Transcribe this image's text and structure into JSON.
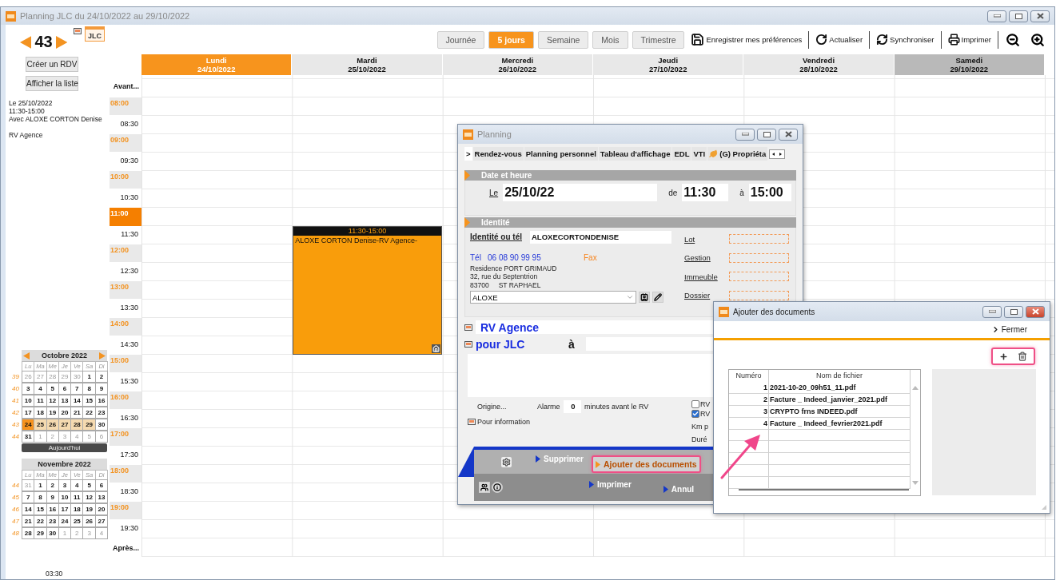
{
  "window": {
    "title": "Planning JLC du 24/10/2022 au 29/10/2022"
  },
  "week": {
    "number": "43"
  },
  "agenda_badge": "JLC",
  "views": [
    {
      "label": "Journée",
      "selected": false
    },
    {
      "label": "5 jours",
      "selected": true
    },
    {
      "label": "Semaine",
      "selected": false
    },
    {
      "label": "Mois",
      "selected": false
    },
    {
      "label": "Trimestre",
      "selected": false
    }
  ],
  "tools": [
    {
      "kind": "save",
      "label": "Enregistrer mes préférences"
    },
    {
      "kind": "refresh",
      "label": "Actualiser"
    },
    {
      "kind": "sync",
      "label": "Synchroniser"
    },
    {
      "kind": "print",
      "label": "Imprimer"
    },
    {
      "kind": "zoom-out"
    },
    {
      "kind": "zoom-in"
    }
  ],
  "sidebar": {
    "buttons": [
      "Créer un RDV",
      "Afficher la liste"
    ],
    "summary": [
      "Le 25/10/2022",
      "11:30-15:00",
      "Avec ALOXE CORTON Denise"
    ],
    "note": "RV Agence",
    "calendars": [
      {
        "title": "Octobre 2022",
        "nav": true,
        "weekdays": [
          "Lu",
          "Ma",
          "Me",
          "Je",
          "Ve",
          "Sa",
          "Di"
        ],
        "today_button": "Aujourd'hui",
        "weeks": [
          {
            "number": "39",
            "days": [
              {
                "label": "26",
                "kind": "outside"
              },
              {
                "label": "27",
                "kind": "outside"
              },
              {
                "label": "28",
                "kind": "outside"
              },
              {
                "label": "29",
                "kind": "outside"
              },
              {
                "label": "30",
                "kind": "outside"
              },
              {
                "label": "1",
                "kind": "day"
              },
              {
                "label": "2",
                "kind": "day"
              }
            ]
          },
          {
            "number": "40",
            "days": [
              {
                "label": "3",
                "kind": "day"
              },
              {
                "label": "4",
                "kind": "day"
              },
              {
                "label": "5",
                "kind": "day"
              },
              {
                "label": "6",
                "kind": "day"
              },
              {
                "label": "7",
                "kind": "day"
              },
              {
                "label": "8",
                "kind": "day"
              },
              {
                "label": "9",
                "kind": "day"
              }
            ]
          },
          {
            "number": "41",
            "days": [
              {
                "label": "10",
                "kind": "day"
              },
              {
                "label": "11",
                "kind": "day"
              },
              {
                "label": "12",
                "kind": "day"
              },
              {
                "label": "13",
                "kind": "day"
              },
              {
                "label": "14",
                "kind": "day"
              },
              {
                "label": "15",
                "kind": "day"
              },
              {
                "label": "16",
                "kind": "day"
              }
            ]
          },
          {
            "number": "42",
            "days": [
              {
                "label": "17",
                "kind": "day"
              },
              {
                "label": "18",
                "kind": "day"
              },
              {
                "label": "19",
                "kind": "day"
              },
              {
                "label": "20",
                "kind": "day"
              },
              {
                "label": "21",
                "kind": "day"
              },
              {
                "label": "22",
                "kind": "day"
              },
              {
                "label": "23",
                "kind": "day"
              }
            ]
          },
          {
            "number": "43",
            "days": [
              {
                "label": "24",
                "kind": "today"
              },
              {
                "label": "25",
                "kind": "range"
              },
              {
                "label": "26",
                "kind": "range"
              },
              {
                "label": "27",
                "kind": "range"
              },
              {
                "label": "28",
                "kind": "range"
              },
              {
                "label": "29",
                "kind": "range"
              },
              {
                "label": "30",
                "kind": "day"
              }
            ]
          },
          {
            "number": "44",
            "days": [
              {
                "label": "31",
                "kind": "day"
              },
              {
                "label": "1",
                "kind": "outside"
              },
              {
                "label": "2",
                "kind": "outside"
              },
              {
                "label": "3",
                "kind": "outside"
              },
              {
                "label": "4",
                "kind": "outside"
              },
              {
                "label": "5",
                "kind": "outside"
              },
              {
                "label": "6",
                "kind": "outside"
              }
            ]
          }
        ]
      },
      {
        "title": "Novembre 2022",
        "nav": false,
        "weekdays": [
          "Lu",
          "Ma",
          "Me",
          "Je",
          "Ve",
          "Sa",
          "Di"
        ],
        "weeks": [
          {
            "number": "44",
            "days": [
              {
                "label": "31",
                "kind": "outside"
              },
              {
                "label": "1",
                "kind": "day"
              },
              {
                "label": "2",
                "kind": "day"
              },
              {
                "label": "3",
                "kind": "day"
              },
              {
                "label": "4",
                "kind": "day"
              },
              {
                "label": "5",
                "kind": "day"
              },
              {
                "label": "6",
                "kind": "day"
              }
            ]
          },
          {
            "number": "45",
            "days": [
              {
                "label": "7",
                "kind": "day"
              },
              {
                "label": "8",
                "kind": "day"
              },
              {
                "label": "9",
                "kind": "day"
              },
              {
                "label": "10",
                "kind": "day"
              },
              {
                "label": "11",
                "kind": "day"
              },
              {
                "label": "12",
                "kind": "day"
              },
              {
                "label": "13",
                "kind": "day"
              }
            ]
          },
          {
            "number": "46",
            "days": [
              {
                "label": "14",
                "kind": "day"
              },
              {
                "label": "15",
                "kind": "day"
              },
              {
                "label": "16",
                "kind": "day"
              },
              {
                "label": "17",
                "kind": "day"
              },
              {
                "label": "18",
                "kind": "day"
              },
              {
                "label": "19",
                "kind": "day"
              },
              {
                "label": "20",
                "kind": "day"
              }
            ]
          },
          {
            "number": "47",
            "days": [
              {
                "label": "21",
                "kind": "day"
              },
              {
                "label": "22",
                "kind": "day"
              },
              {
                "label": "23",
                "kind": "day"
              },
              {
                "label": "24",
                "kind": "day"
              },
              {
                "label": "25",
                "kind": "day"
              },
              {
                "label": "26",
                "kind": "day"
              },
              {
                "label": "27",
                "kind": "day"
              }
            ]
          },
          {
            "number": "48",
            "days": [
              {
                "label": "28",
                "kind": "day"
              },
              {
                "label": "29",
                "kind": "day"
              },
              {
                "label": "30",
                "kind": "day"
              },
              {
                "label": "1",
                "kind": "outside"
              },
              {
                "label": "2",
                "kind": "outside"
              },
              {
                "label": "3",
                "kind": "outside"
              },
              {
                "label": "4",
                "kind": "outside"
              }
            ]
          }
        ]
      }
    ],
    "footer_time": "03:30"
  },
  "days": [
    {
      "name": "Lundi",
      "date": "24/10/2022",
      "kind": "today"
    },
    {
      "name": "Mardi",
      "date": "25/10/2022",
      "kind": "day"
    },
    {
      "name": "Mercredi",
      "date": "26/10/2022",
      "kind": "day"
    },
    {
      "name": "Jeudi",
      "date": "27/10/2022",
      "kind": "day"
    },
    {
      "name": "Vendredi",
      "date": "28/10/2022",
      "kind": "day"
    },
    {
      "name": "Samedi",
      "date": "29/10/2022",
      "kind": "weekend"
    }
  ],
  "times": [
    {
      "label": "Avant...",
      "kind": "edge"
    },
    {
      "label": "08:00",
      "kind": "hour"
    },
    {
      "label": "08:30",
      "kind": "half"
    },
    {
      "label": "09:00",
      "kind": "hour"
    },
    {
      "label": "09:30",
      "kind": "half"
    },
    {
      "label": "10:00",
      "kind": "hour"
    },
    {
      "label": "10:30",
      "kind": "half"
    },
    {
      "label": "11:00",
      "kind": "current"
    },
    {
      "label": "11:30",
      "kind": "half"
    },
    {
      "label": "12:00",
      "kind": "hour"
    },
    {
      "label": "12:30",
      "kind": "half"
    },
    {
      "label": "13:00",
      "kind": "hour"
    },
    {
      "label": "13:30",
      "kind": "half"
    },
    {
      "label": "14:00",
      "kind": "hour"
    },
    {
      "label": "14:30",
      "kind": "half"
    },
    {
      "label": "15:00",
      "kind": "hour"
    },
    {
      "label": "15:30",
      "kind": "half"
    },
    {
      "label": "16:00",
      "kind": "hour"
    },
    {
      "label": "16:30",
      "kind": "half"
    },
    {
      "label": "17:00",
      "kind": "hour"
    },
    {
      "label": "17:30",
      "kind": "half"
    },
    {
      "label": "18:00",
      "kind": "hour"
    },
    {
      "label": "18:30",
      "kind": "half"
    },
    {
      "label": "19:00",
      "kind": "hour"
    },
    {
      "label": "19:30",
      "kind": "half"
    },
    {
      "label": "Après...",
      "kind": "edge"
    }
  ],
  "appointment": {
    "time": "11:30-15:00",
    "text": "ALOXE CORTON Denise-RV Agence-"
  },
  "planning_dialog": {
    "title": "Planning",
    "tabs": [
      {
        "label": ">",
        "kind": "text",
        "selected": true
      },
      {
        "label": "Rendez-vous",
        "kind": "text",
        "selected": false
      },
      {
        "label": "Planning personnel",
        "kind": "text",
        "selected": false
      },
      {
        "label": "Tableau d'affichage",
        "kind": "text",
        "selected": false
      },
      {
        "label": "EDL",
        "kind": "text",
        "selected": false
      },
      {
        "label": "VTI",
        "kind": "text",
        "selected": false
      },
      {
        "label": "(G) Propriéta",
        "kind": "leaf",
        "selected": false
      }
    ],
    "date_section": {
      "title": "Date et heure",
      "date_label": "Le",
      "date": "25/10/22",
      "start_label": "de",
      "start": "11:30",
      "end_label": "à",
      "end": "15:00"
    },
    "identity_section": {
      "title": "Identité",
      "identity_label": "Identité ou tél",
      "identity": "ALOXECORTONDENISE",
      "phone_label": "Tél",
      "phone": "06 08 90 99 95",
      "fax_label": "Fax",
      "address": [
        "Residence PORT GRIMAUD",
        "32, rue du Septentrion"
      ],
      "postcode": "83700",
      "city": "ST RAPHAEL",
      "contact": "ALOXE",
      "links": [
        "Lot",
        "Gestion",
        "Immeuble",
        "Dossier"
      ]
    },
    "subject": "RV Agence",
    "for": "pour JLC",
    "at_label": "à",
    "origin_label": "Origine...",
    "alarm_label": "Alarme",
    "alarm": "0",
    "alarm_unit": "minutes avant le RV",
    "info_label": "Pour information",
    "options": [
      {
        "label": "RV",
        "checked": false
      },
      {
        "label": "RV",
        "checked": true
      }
    ],
    "extra_labels": [
      "Km p",
      "Duré"
    ],
    "actions": [
      {
        "label": "Supprimer",
        "highlighted": false
      },
      {
        "label": "Ajouter des documents",
        "highlighted": true
      },
      {
        "label": "Imprimer",
        "highlighted": false
      },
      {
        "label": "Annul",
        "highlighted": false
      }
    ]
  },
  "documents_dialog": {
    "title": "Ajouter des documents",
    "close_label": "Fermer",
    "toolbar": {
      "highlighted": true
    },
    "columns": [
      "Numéro",
      "Nom de fichier"
    ],
    "rows": [
      {
        "number": "1",
        "file": "2021-10-20_09h51_11.pdf"
      },
      {
        "number": "2",
        "file": "Facture _ Indeed_janvier_2021.pdf"
      },
      {
        "number": "3",
        "file": "CRYPTO frns INDEED.pdf"
      },
      {
        "number": "4",
        "file": "Facture _ Indeed_fevrier2021.pdf"
      }
    ]
  }
}
